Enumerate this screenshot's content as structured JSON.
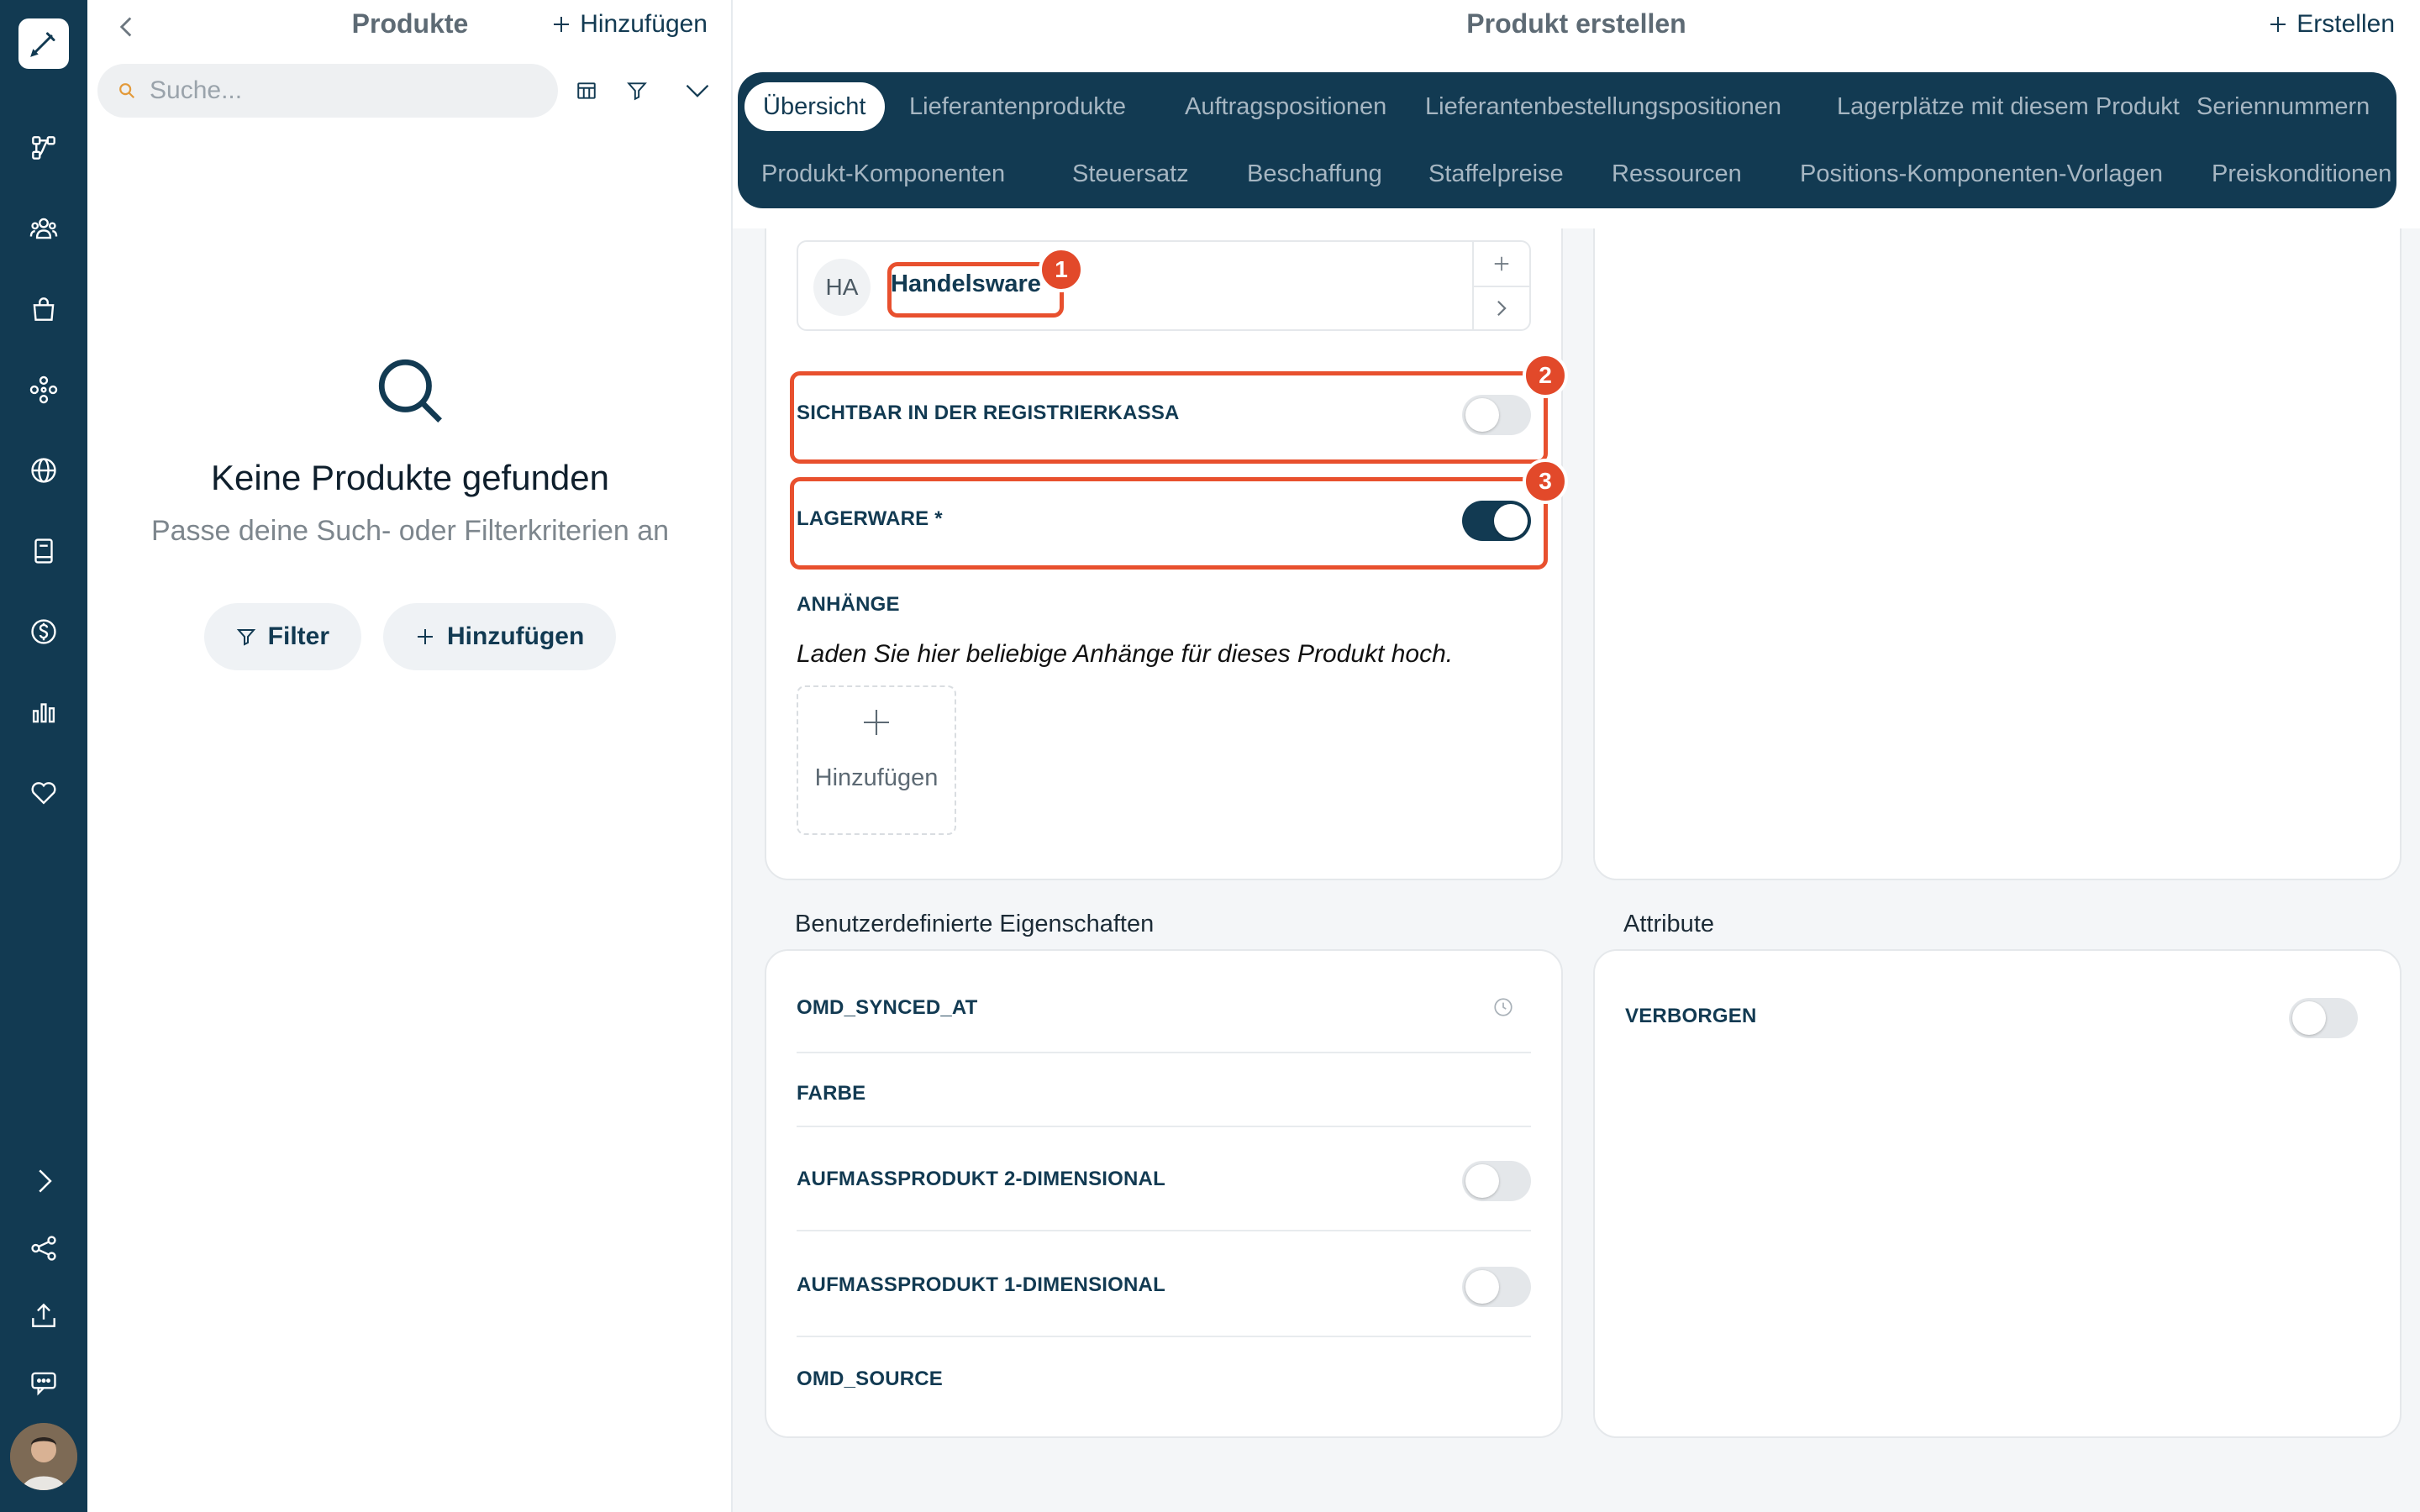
{
  "rail": {
    "icons": [
      "workflow-icon",
      "team-icon",
      "shopping-bag-icon",
      "modules-icon",
      "globe-icon",
      "book-icon",
      "dollar-icon",
      "bar-chart-icon",
      "heart-icon",
      "chevron-right-icon",
      "share-icon",
      "upload-icon",
      "chat-icon"
    ]
  },
  "list": {
    "title": "Produkte",
    "add_label": "Hinzufügen",
    "search_placeholder": "Suche...",
    "empty_title": "Keine Produkte gefunden",
    "empty_subtitle": "Passe deine Such- oder Filterkriterien an",
    "filter_label": "Filter",
    "empty_add_label": "Hinzufügen"
  },
  "main": {
    "title": "Produkt erstellen",
    "create_label": "Erstellen",
    "tabs_row1": [
      "Übersicht",
      "Lieferantenprodukte",
      "Auftragspositionen",
      "Lieferantenbestellungspositionen",
      "Lagerplätze mit diesem Produkt",
      "Seriennummern"
    ],
    "tabs_row2": [
      "Produkt-Komponenten",
      "Steuersatz",
      "Beschaffung",
      "Staffelpreise",
      "Ressourcen",
      "Positions-Komponenten-Vorlagen",
      "Preiskonditionen"
    ]
  },
  "form": {
    "category_initials": "HA",
    "category_name": "Handelsware",
    "visible_pos_label": "SICHTBAR IN DER REGISTRIERKASSA",
    "visible_pos_on": false,
    "stock_label": "LAGERWARE *",
    "stock_on": true,
    "attachments_label": "ANHÄNGE",
    "attachments_text": "Laden Sie hier beliebige Anhänge für dieses Produkt hoch.",
    "upload_label": "Hinzufügen"
  },
  "annotations": [
    "1",
    "2",
    "3"
  ],
  "custom": {
    "title": "Benutzerdefinierte Eigenschaften",
    "synced_at": "OMD_SYNCED_AT",
    "color": "FARBE",
    "measure_2d": "AUFMASSPRODUKT 2-DIMENSIONAL",
    "measure_2d_on": false,
    "measure_1d": "AUFMASSPRODUKT 1-DIMENSIONAL",
    "measure_1d_on": false,
    "source": "OMD_SOURCE"
  },
  "attributes": {
    "title": "Attribute",
    "hidden_label": "VERBORGEN",
    "hidden_on": false
  },
  "colors": {
    "navy": "#123a52",
    "highlight": "#e8502e"
  }
}
